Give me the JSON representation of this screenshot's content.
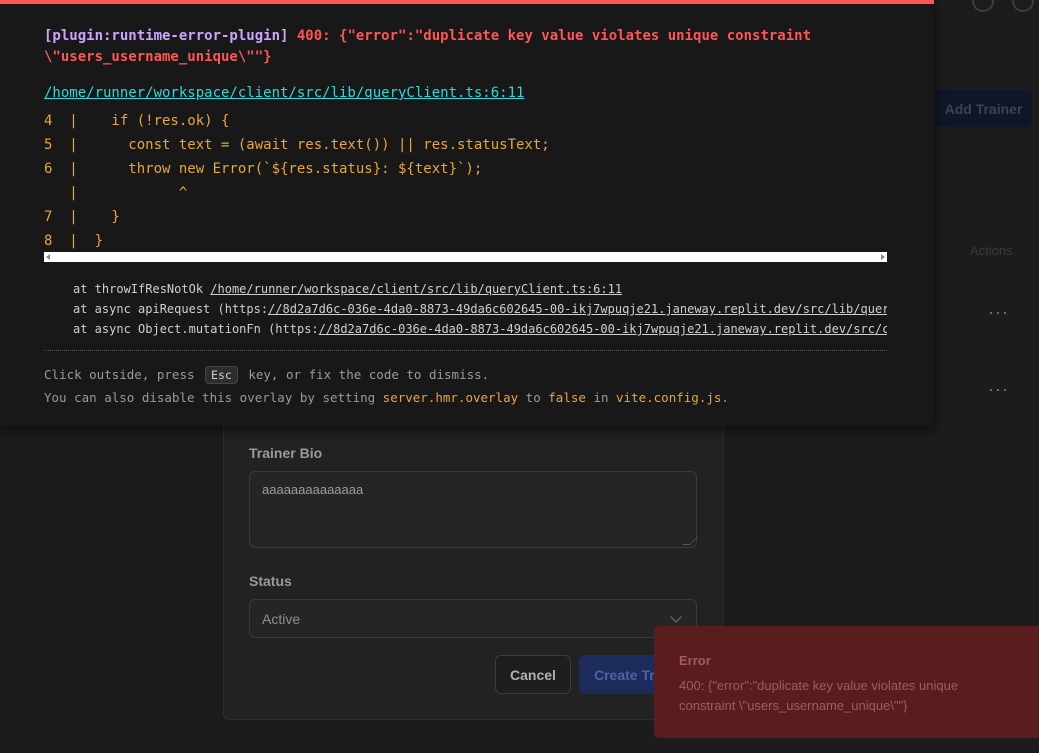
{
  "overlay": {
    "plugin": "[plugin:runtime-error-plugin]",
    "message_line1": "400: {\"error\":\"duplicate key value violates unique constraint",
    "message_line2": "\\\"users_username_unique\\\"\"}",
    "file": "/home/runner/workspace/client/src/lib/queryClient.ts:6:11",
    "frame_lines": [
      "4  |    if (!res.ok) {",
      "5  |      const text = (await res.text()) || res.statusText;",
      "6  |      throw new Error(`${res.status}: ${text}`);",
      "   |            ^",
      "7  |    }",
      "8  |  }"
    ],
    "stack": [
      {
        "prefix": "at throwIfResNotOk ",
        "link": "/home/runner/workspace/client/src/lib/queryClient.ts:6:11",
        "suffix": ""
      },
      {
        "prefix": "at async apiRequest (https:",
        "link": "//8d2a7d6c-036e-4da0-8873-49da6c602645-00-ikj7wpuqje21.janeway.replit.dev/src/lib/query",
        "suffix": ""
      },
      {
        "prefix": "at async Object.mutationFn (https:",
        "link": "//8d2a7d6c-036e-4da0-8873-49da6c602645-00-ikj7wpuqje21.janeway.replit.dev/src/co",
        "suffix": ""
      }
    ],
    "tip1_before": "Click outside, press",
    "tip1_key": "Esc",
    "tip1_after": "key, or fix the code to dismiss.",
    "tip2_a": "You can also disable this overlay by setting",
    "tip2_code1": "server.hmr.overlay",
    "tip2_b": "to",
    "tip2_code2": "false",
    "tip2_c": "in",
    "tip2_code3": "vite.config.js",
    "tip2_d": "."
  },
  "background": {
    "add_trainer_label": "Add Trainer",
    "actions_header": "Actions",
    "row_menu": "···"
  },
  "modal": {
    "bio_label": "Trainer Bio",
    "bio_value": "aaaaaaaaaaaaaa",
    "status_label": "Status",
    "status_value": "Active",
    "cancel_label": "Cancel",
    "create_label": "Create Trainer"
  },
  "toast": {
    "title": "Error",
    "message": "400: {\"error\":\"duplicate key value violates unique constraint \\\"users_username_unique\\\"\"}"
  }
}
